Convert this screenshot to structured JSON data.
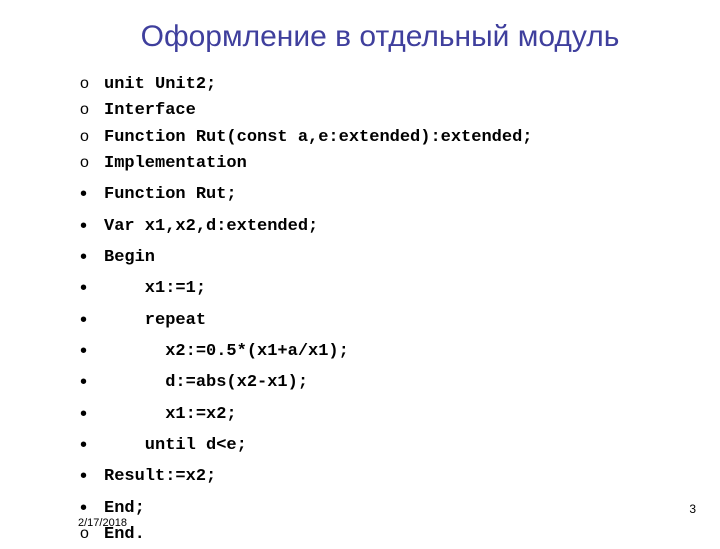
{
  "title": "Оформление в отдельный модуль",
  "lines": [
    {
      "bullet": "circle",
      "text": "unit Unit2;"
    },
    {
      "bullet": "circle",
      "text": "Interface"
    },
    {
      "bullet": "circle",
      "text": "Function Rut(const a,e:extended):extended;"
    },
    {
      "bullet": "circle",
      "text": "Implementation"
    },
    {
      "bullet": "dot",
      "text": "Function Rut;"
    },
    {
      "bullet": "dot",
      "text": "Var x1,x2,d:extended;"
    },
    {
      "bullet": "dot",
      "text": "Begin"
    },
    {
      "bullet": "dot",
      "text": "    x1:=1;"
    },
    {
      "bullet": "dot",
      "text": "    repeat"
    },
    {
      "bullet": "dot",
      "text": "      x2:=0.5*(x1+a/x1);"
    },
    {
      "bullet": "dot",
      "text": "      d:=abs(x2-x1);"
    },
    {
      "bullet": "dot",
      "text": "      x1:=x2;"
    },
    {
      "bullet": "dot",
      "text": "    until d<e;"
    },
    {
      "bullet": "dot",
      "text": "Result:=x2;"
    },
    {
      "bullet": "dot",
      "text": "End;"
    },
    {
      "bullet": "circle",
      "text": "End.",
      "overlayDate": "2/17/2018"
    }
  ],
  "pageNumber": "3"
}
